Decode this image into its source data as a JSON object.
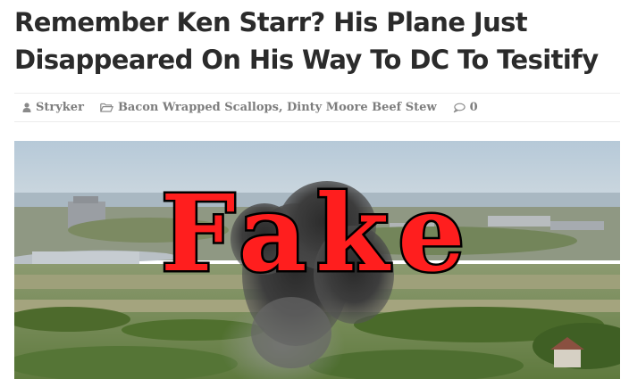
{
  "article": {
    "title": "Remember Ken Starr? His Plane Just Disappeared On His Way To DC To Tesitify",
    "meta": {
      "author": "Stryker",
      "categories": "Bacon Wrapped Scallops, Dinty Moore Beef Stew",
      "comment_count": "0"
    },
    "featured_image": {
      "description": "aerial photo of a smoke cloud over fields near a coastal town",
      "stamp_text": "Fake",
      "stamp_color": "#ff1e1e"
    }
  },
  "colors": {
    "title": "#2b2b2b",
    "meta": "#7d7d7d",
    "rule": "#ececec"
  },
  "icons": {
    "author": "user-icon",
    "categories": "folder-icon",
    "comments": "comment-icon"
  }
}
